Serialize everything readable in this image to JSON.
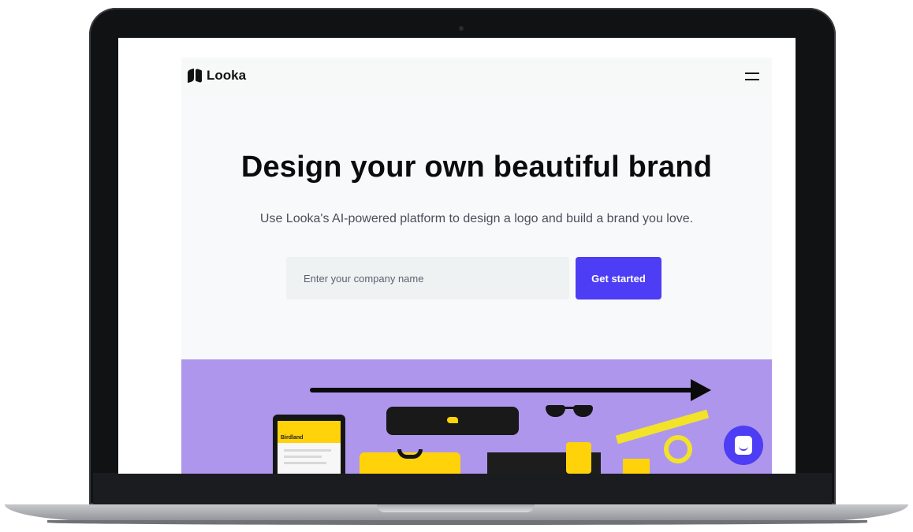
{
  "nav": {
    "brand": "Looka"
  },
  "hero": {
    "title": "Design your own beautiful brand",
    "subtitle": "Use Looka's AI-powered platform to design a logo and build a brand you love.",
    "input_placeholder": "Enter your company name",
    "cta_label": "Get started"
  },
  "showcase": {
    "tablet_brand": "Birdland",
    "background_color": "#ae96ec"
  },
  "colors": {
    "accent": "#4d3df4",
    "brand_yellow": "#ffd20a"
  },
  "icons": [
    "logo-icon",
    "hamburger-menu-icon",
    "arrow-right-icon",
    "chat-icon"
  ]
}
